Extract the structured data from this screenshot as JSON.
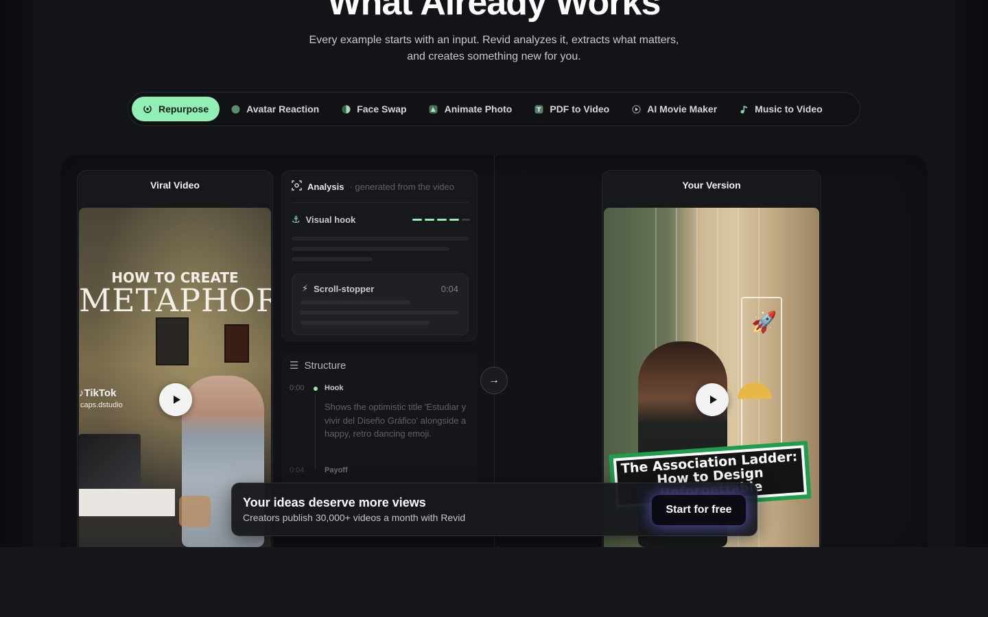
{
  "hero": {
    "title": "What Already Works",
    "subtitle_line1": "Every example starts with an input. Revid analyzes it, extracts what matters,",
    "subtitle_line2": "and creates something new for you."
  },
  "tabs": [
    {
      "label": "Repurpose",
      "icon": "repurpose-icon",
      "active": true
    },
    {
      "label": "Avatar Reaction",
      "icon": "avatar-icon"
    },
    {
      "label": "Face Swap",
      "icon": "face-swap-icon"
    },
    {
      "label": "Animate Photo",
      "icon": "animate-photo-icon"
    },
    {
      "label": "PDF to Video",
      "icon": "pdf-icon"
    },
    {
      "label": "AI Movie Maker",
      "icon": "movie-icon"
    },
    {
      "label": "Music to Video",
      "icon": "music-icon"
    }
  ],
  "viral": {
    "title": "Viral Video",
    "overlay_line1": "HOW TO CREATE",
    "overlay_line2": "METAPHOR",
    "tiktok": "TikTok",
    "handle": "caps.dstudio"
  },
  "analysis": {
    "title": "Analysis",
    "subtitle": "· generated from the video",
    "visual_hook": "Visual hook",
    "scroll_stopper": "Scroll-stopper",
    "scroll_time": "0:04"
  },
  "structure": {
    "title": "Structure",
    "items": [
      {
        "time": "0:00",
        "label": "Hook",
        "desc": "Shows the optimistic title 'Estudiar y vivir del Diseño Gráfico' alongside a happy, retro dancing emoji."
      },
      {
        "time": "0:04",
        "label": "Payoff"
      }
    ]
  },
  "version": {
    "title": "Your Version",
    "sign": "The Association Ladder: How to Design Unforgettable"
  },
  "cta": {
    "title": "Your ideas deserve more views",
    "subtitle": "Creators publish 30,000+ videos a month with Revid",
    "button": "Start for free"
  },
  "colors": {
    "accent": "#8fefb5",
    "background": "#141519"
  }
}
